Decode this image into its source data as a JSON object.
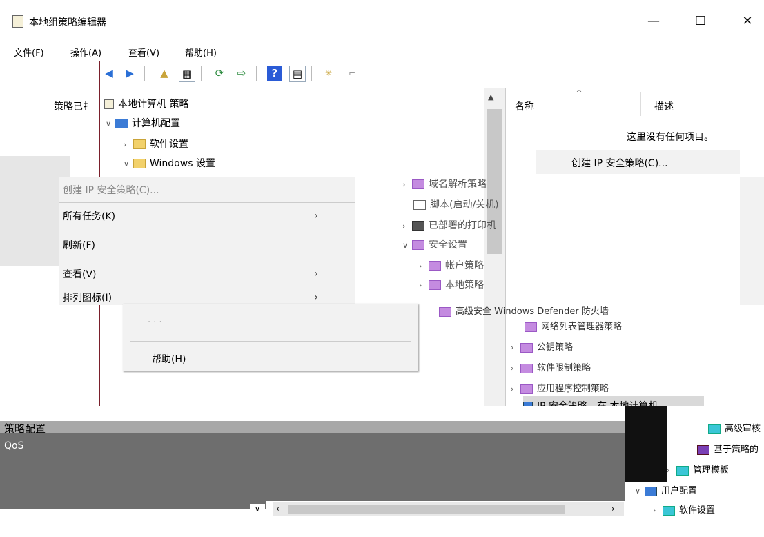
{
  "window": {
    "title": "本地组策略编辑器",
    "min_glyph": "—",
    "max_glyph": "☐",
    "close_glyph": "✕"
  },
  "menubar": {
    "items": [
      "文件(F)",
      "操作(A)",
      "查看(V)",
      "帮助(H)"
    ]
  },
  "left_header": {
    "label": "策略已扌"
  },
  "tree": {
    "root": "本地计算机 策略",
    "computer_config": "计算机配置",
    "software_settings": "软件设置",
    "windows_settings": "Windows 设置",
    "dns_client": "域名解析策略",
    "scripts": "脚本(启动/关机)",
    "deployed_printers": "已部署的打印机",
    "security_settings": "安全设置",
    "account_policies": "帐户策略",
    "local_policies": "本地策略",
    "adv_firewall": "高级安全 Windows Defender 防火墙",
    "network_list": "网络列表管理器策略",
    "public_key": "公钥策略",
    "software_restriction": "软件限制策略",
    "app_control": "应用程序控制策略",
    "ipsec_policies": "IP 安全策略，在 本地计算机",
    "adv_audit": "高级审核",
    "policy_qos": "基于策略的",
    "admin_templates": "管理模板",
    "user_config": "用户配置",
    "user_software": "软件设置"
  },
  "context_menu": {
    "items": [
      {
        "label": "创建 IP 安全策略(C)...",
        "has_submenu": false
      },
      {
        "label": "所有任务(K)",
        "has_submenu": true
      },
      {
        "label": "刷新(F)",
        "has_submenu": false
      },
      {
        "label": "查看(V)",
        "has_submenu": true
      },
      {
        "label": "排列图标(I)",
        "has_submenu": true
      },
      {
        "label": "帮助(H)",
        "has_submenu": false
      }
    ],
    "arrow": "›"
  },
  "right_pane": {
    "col_name": "名称",
    "col_desc": "描述",
    "empty_text": "这里没有任何项目。",
    "menu_item": "创建 IP 安全策略(C)..."
  },
  "bottom": {
    "policy_config": "策略配置",
    "qos": "QoS"
  },
  "colors": {
    "folder": "#f2d16b",
    "security_folder": "#c48be0",
    "menu_bg": "#f2f2f2"
  }
}
